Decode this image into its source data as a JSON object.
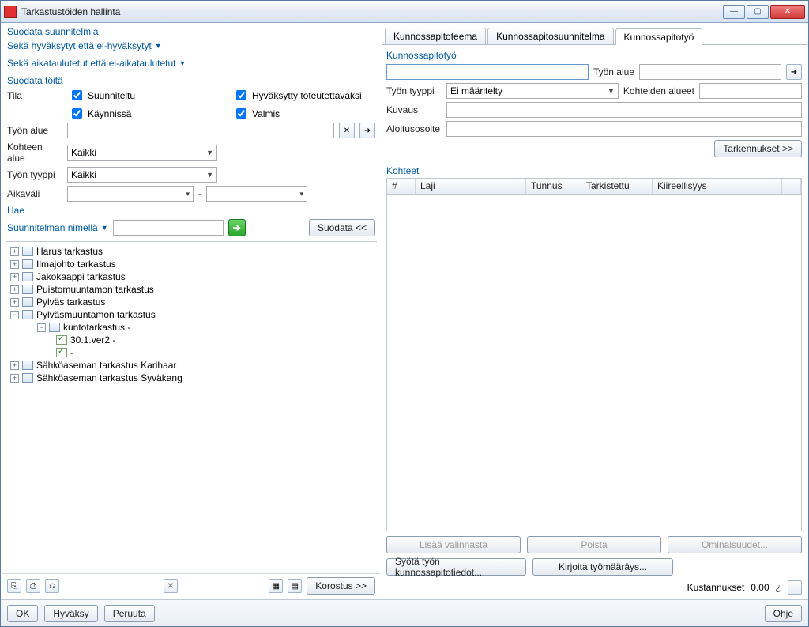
{
  "window": {
    "title": "Tarkastustöiden hallinta"
  },
  "left": {
    "filterPlans": "Suodata suunnitelmia",
    "approvalFilter": "Sekä hyväksytyt että ei-hyväksytyt",
    "scheduleFilter": "Sekä aikataulutetut että ei-aikataulutetut",
    "filterJobs": "Suodata töitä",
    "stateLabel": "Tila",
    "statePlanned": "Suunniteltu",
    "stateRunning": "Käynnissä",
    "stateAccepted": "Hyväksytty toteutettavaksi",
    "stateDone": "Valmis",
    "workArea": "Työn alue",
    "itemArea": "Kohteen alue",
    "itemAreaAll": "Kaikki",
    "workType": "Työn tyyppi",
    "workTypeAll": "Kaikki",
    "interval": "Aikaväli",
    "intervalDash": "-",
    "search": "Hae",
    "searchBy": "Suunnitelman nimellä",
    "filterBtn": "Suodata <<",
    "highlightBtn": "Korostus >>"
  },
  "tree": [
    {
      "label": "Harus tarkastus",
      "exp": "+"
    },
    {
      "label": "Ilmajohto tarkastus",
      "exp": "+"
    },
    {
      "label": "Jakokaappi tarkastus",
      "exp": "+"
    },
    {
      "label": "Puistomuuntamon tarkastus",
      "exp": "+"
    },
    {
      "label": "Pylväs tarkastus",
      "exp": "+"
    },
    {
      "label": "Pylväsmuuntamon tarkastus",
      "exp": "−",
      "children": [
        {
          "label": "kuntotarkastus -",
          "exp": "−",
          "children": [
            {
              "label": "30.1.ver2 -",
              "chk": true
            },
            {
              "label": "-",
              "chk": true
            }
          ]
        }
      ]
    },
    {
      "label": "Sähköaseman tarkastus Karihaar",
      "exp": "+"
    },
    {
      "label": "Sähköaseman tarkastus Syväkang",
      "exp": "+"
    }
  ],
  "tabs": {
    "theme": "Kunnossapitoteema",
    "plan": "Kunnossapitosuunnitelma",
    "work": "Kunnossapitotyö"
  },
  "form": {
    "workLabel": "Kunnossapitotyö",
    "workAreaLabel": "Työn alue",
    "workTypeLabel": "Työn tyyppi",
    "workTypeValue": "Ei määritelty",
    "itemRegionsLabel": "Kohteiden alueet",
    "descLabel": "Kuvaus",
    "startAddrLabel": "Aloitusosoite",
    "detailsBtn": "Tarkennukset >>",
    "itemsLabel": "Kohteet",
    "columns": {
      "idx": "#",
      "type": "Laji",
      "code": "Tunnus",
      "checked": "Tarkistettu",
      "urgency": "Kiireellisyys"
    },
    "addFromSel": "Lisää valinnasta",
    "remove": "Poista",
    "props": "Ominaisuudet...",
    "enterMaint": "Syötä työn kunnossapitotiedot...",
    "writeOrder": "Kirjoita työmääräys...",
    "costLabel": "Kustannukset",
    "costValue": "0.00",
    "currency": "¿"
  },
  "footer": {
    "ok": "OK",
    "approve": "Hyväksy",
    "cancel": "Peruuta",
    "help": "Ohje"
  }
}
